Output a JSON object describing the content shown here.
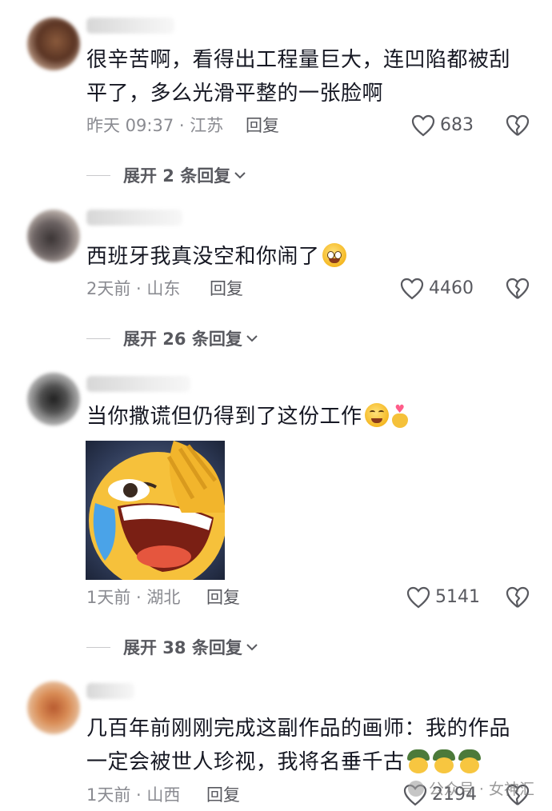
{
  "comments": [
    {
      "text": "很辛苦啊，看得出工程量巨大，连凹陷都被刮平了，多么光滑平整的一张脸啊",
      "time": "昨天 09:37 · 江苏",
      "reply": "回复",
      "likes": "683",
      "expand": "展开 2 条回复"
    },
    {
      "text": "西班牙我真没空和你闹了",
      "time": "2天前 · 山东",
      "reply": "回复",
      "likes": "4460",
      "expand": "展开 26 条回复"
    },
    {
      "text": "当你撒谎但仍得到了这份工作",
      "time": "1天前 · 湖北",
      "reply": "回复",
      "likes": "5141",
      "expand": "展开 38 条回复"
    },
    {
      "text": "几百年前刚刚完成这副作品的画师：我的作品一定会被世人珍视，我将名垂千古",
      "time": "1天前 · 山西",
      "reply": "回复",
      "likes": "2194"
    }
  ],
  "watermark": "公众号 · 女神汇",
  "icons": {
    "like": "heart-outline-icon",
    "dislike": "broken-heart-icon",
    "expand": "chevron-down-icon"
  },
  "colors": {
    "text": "#161823",
    "meta": "#8a8b91",
    "action": "#58595f"
  }
}
